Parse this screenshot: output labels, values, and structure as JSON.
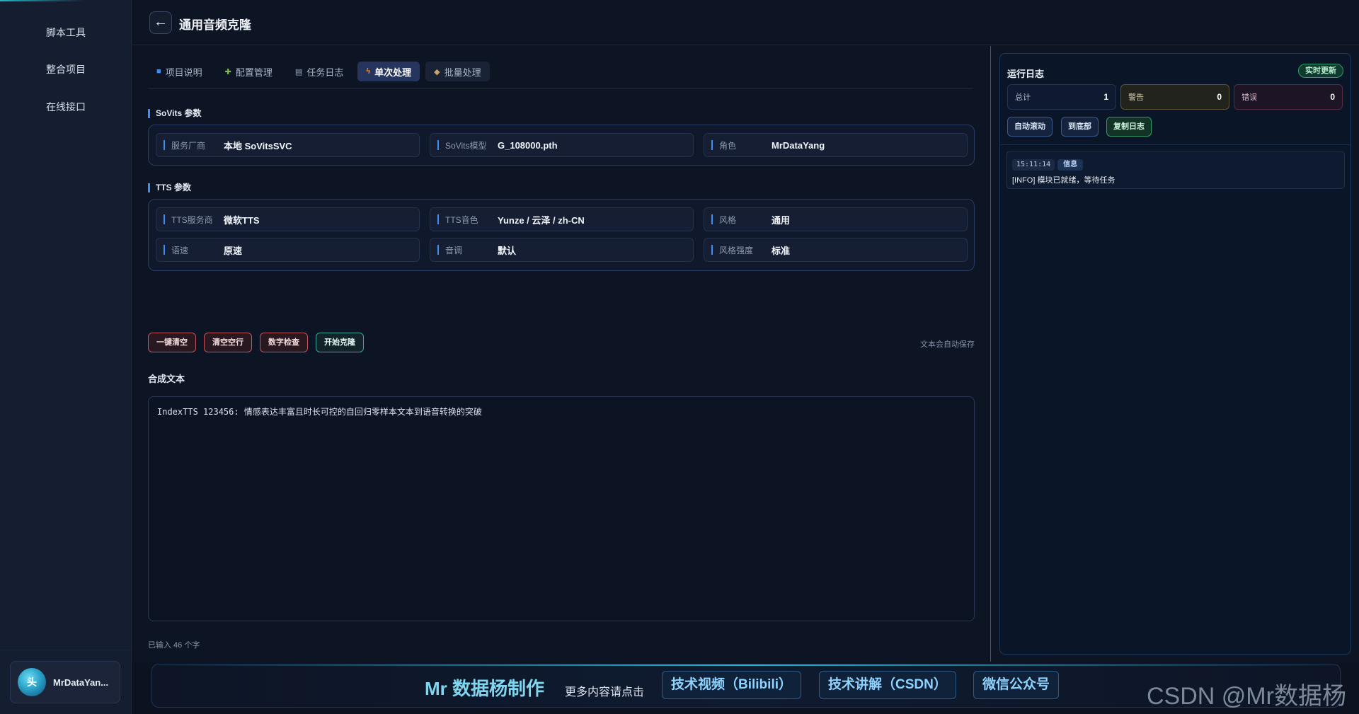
{
  "sidebar": {
    "items": [
      {
        "label": "脚本工具"
      },
      {
        "label": "整合项目"
      },
      {
        "label": "在线接口"
      }
    ],
    "user": {
      "avatar_text": "头",
      "name": "MrDataYan..."
    }
  },
  "header": {
    "back_icon": "←",
    "title": "通用音频克隆"
  },
  "tabs": [
    {
      "label": "项目说明",
      "icon": "book-icon"
    },
    {
      "label": "配置管理",
      "icon": "puzzle-icon"
    },
    {
      "label": "任务日志",
      "icon": "document-icon"
    },
    {
      "label": "单次处理",
      "icon": "lightning-icon"
    },
    {
      "label": "批量处理",
      "icon": "package-icon"
    }
  ],
  "sovits": {
    "title": "SoVits 参数",
    "fields": [
      {
        "label": "服务厂商",
        "value": "本地 SoVitsSVC"
      },
      {
        "label": "SoVits模型",
        "value": "G_108000.pth"
      },
      {
        "label": "角色",
        "value": "MrDataYang"
      }
    ]
  },
  "tts": {
    "title": "TTS 参数",
    "fields": [
      {
        "label": "TTS服务商",
        "value": "微软TTS"
      },
      {
        "label": "TTS音色",
        "value": "Yunze / 云泽 / zh-CN"
      },
      {
        "label": "风格",
        "value": "通用"
      },
      {
        "label": "语速",
        "value": "原速"
      },
      {
        "label": "音调",
        "value": "默认"
      },
      {
        "label": "风格强度",
        "value": "标准"
      }
    ]
  },
  "actions": {
    "clear_all": "一键清空",
    "clear_empty": "清空空行",
    "check_numbers": "数字检查",
    "start_clone": "开始克隆",
    "autosave": "文本会自动保存"
  },
  "synthesis": {
    "title": "合成文本",
    "text": "IndexTTS 123456: 情感表达丰富且时长可控的自回归零样本文本到语音转换的突破",
    "char_count": "已输入 46 个字"
  },
  "log": {
    "title": "运行日志",
    "live_badge": "实时更新",
    "stats": [
      {
        "label": "总计",
        "value": "1"
      },
      {
        "label": "警告",
        "value": "0"
      },
      {
        "label": "错误",
        "value": "0"
      }
    ],
    "buttons": {
      "auto_scroll": "自动滚动",
      "to_bottom": "到底部",
      "copy": "复制日志"
    },
    "entries": [
      {
        "time": "15:11:14",
        "level": "信息",
        "message": "[INFO] 模块已就绪，等待任务"
      }
    ]
  },
  "footer": {
    "brand": "Mr 数据杨制作",
    "sub": "更多内容请点击",
    "links": [
      "技术视频（Bilibili）",
      "技术讲解（CSDN）",
      "微信公众号"
    ]
  },
  "watermark": "CSDN @Mr数据杨",
  "colors": {
    "accent": "#3f8ff0",
    "teal": "#22b4c8",
    "active_tab": "#25355e"
  }
}
